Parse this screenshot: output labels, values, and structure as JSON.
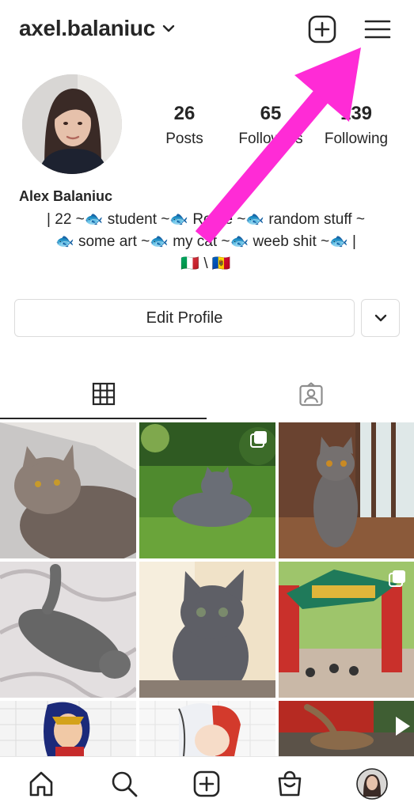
{
  "header": {
    "username": "axel.balaniuc"
  },
  "profile": {
    "full_name": "Alex Balaniuc",
    "bio_lines": [
      "| 22  ~🐟  student  ~🐟  Rome  ~🐟  random stuff  ~",
      "🐟  some art  ~🐟  my cat  ~🐟  weeb shit  ~🐟 |",
      "🇮🇹 \\ 🇲🇩"
    ],
    "stats": {
      "posts_count": "26",
      "posts_label": "Posts",
      "followers_count": "65",
      "followers_label": "Followers",
      "following_count": "139",
      "following_label": "Following"
    }
  },
  "actions": {
    "edit_profile_label": "Edit Profile"
  },
  "colors": {
    "accent_arrow": "#ff2bd6",
    "text": "#262626",
    "border": "#dbdbdb"
  },
  "icons": {
    "header": [
      "chevron-down-icon",
      "new-post-icon",
      "menu-icon"
    ],
    "tabs": [
      "grid-icon",
      "tagged-icon"
    ],
    "nav": [
      "home-icon",
      "search-icon",
      "create-icon",
      "shop-icon",
      "profile-avatar"
    ]
  }
}
